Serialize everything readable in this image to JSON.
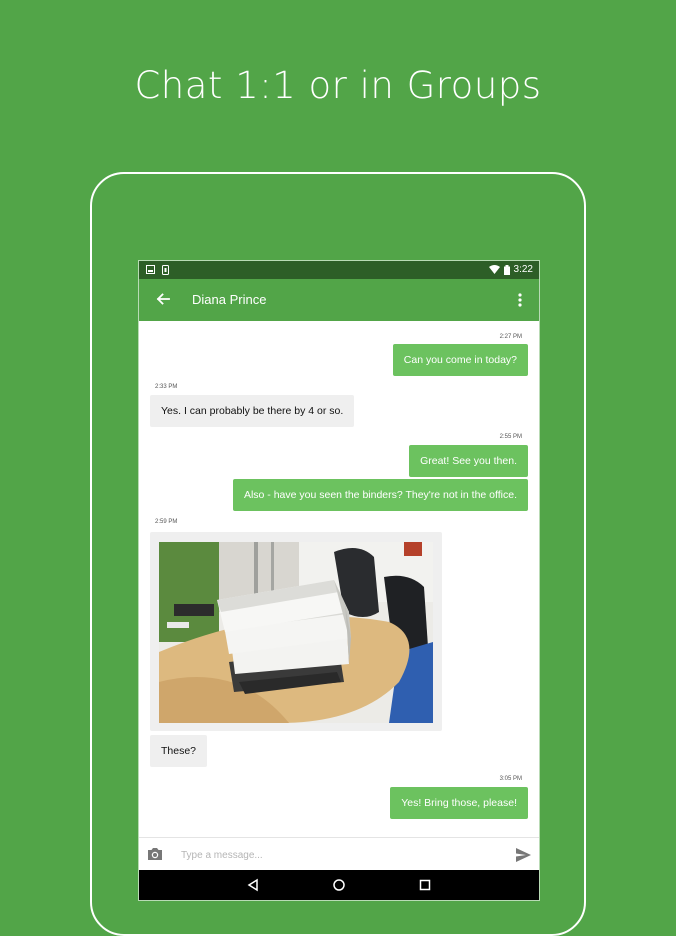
{
  "headline": "Chat 1:1 or in Groups",
  "status_bar": {
    "time": "3:22"
  },
  "app_bar": {
    "title": "Diana Prince"
  },
  "messages": [
    {
      "time": "2:27 PM",
      "text": "Can you come in today?"
    },
    {
      "time": "2:33 PM",
      "text": "Yes. I can probably be there by 4 or so."
    },
    {
      "time": "2:55 PM",
      "text": "Great! See you then."
    },
    {
      "text": "Also - have you seen the binders? They're not in the office."
    },
    {
      "time": "2:59 PM",
      "text": "These?"
    },
    {
      "time": "3:05 PM",
      "text": "Yes! Bring those, please!"
    }
  ],
  "composer": {
    "placeholder": "Type a message..."
  },
  "colors": {
    "background": "#52a548",
    "status_bar": "#2d5e27",
    "outgoing_bubble": "#6cc25f",
    "incoming_bubble": "#efefef"
  },
  "icons": {
    "back": "arrow-left-icon",
    "overflow": "more-vert-icon",
    "camera": "camera-icon",
    "send": "send-icon",
    "nav_back": "triangle-back-icon",
    "nav_home": "circle-home-icon",
    "nav_recents": "square-recents-icon"
  }
}
